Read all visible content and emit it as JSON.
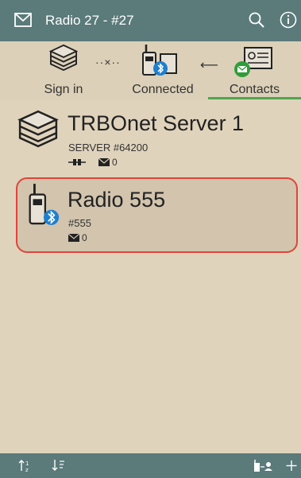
{
  "appbar": {
    "title": "Radio 27 - #27",
    "icons": [
      "mail-icon",
      "search-icon",
      "info-icon"
    ]
  },
  "steps": [
    {
      "label": "Sign in",
      "icon": "server-stack-icon"
    },
    {
      "label": "Connected",
      "icon": "radio-bluetooth-icon"
    },
    {
      "label": "Contacts",
      "icon": "contact-card-icon"
    }
  ],
  "contacts": [
    {
      "name": "TRBOnet Server 1",
      "subtitle": "SERVER #64200",
      "message_count": "0",
      "icon": "server-stack-icon"
    },
    {
      "name": "Radio 555",
      "subtitle": "#555",
      "message_count": "0",
      "icon": "radio-bluetooth-icon",
      "selected": true
    }
  ],
  "bottombar": {
    "icons": [
      "sort-ascending-icon",
      "sort-descending-icon",
      "radio-to-contact-icon",
      "add-icon"
    ]
  },
  "colors": {
    "appbar": "#5b7a7a",
    "background": "#e0d3bc",
    "selection": "#e0453a",
    "active_tab": "#4fa64f",
    "bluetooth": "#1e7fd0"
  }
}
